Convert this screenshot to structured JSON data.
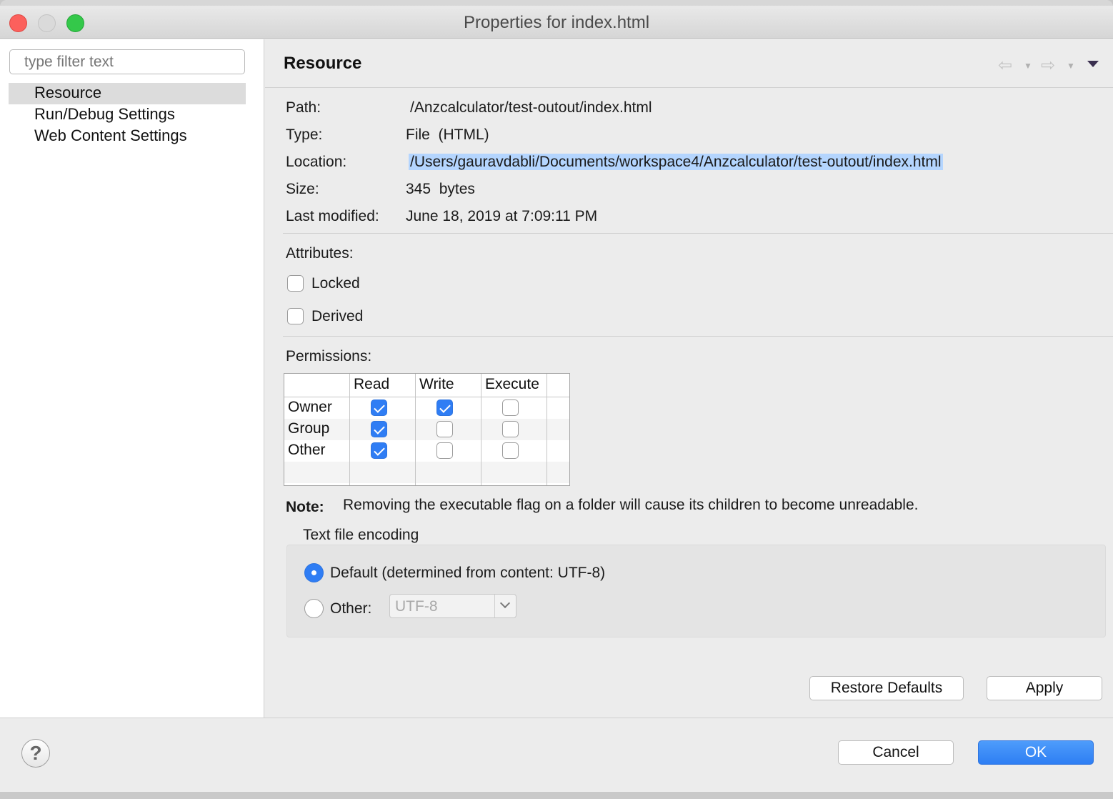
{
  "window": {
    "title": "Properties for index.html"
  },
  "nav": {
    "filter_placeholder": "type filter text",
    "items": [
      {
        "label": "Resource",
        "selected": true
      },
      {
        "label": "Run/Debug Settings",
        "selected": false
      },
      {
        "label": "Web Content Settings",
        "selected": false
      }
    ]
  },
  "page": {
    "title": "Resource",
    "info": {
      "path_label": "Path:",
      "path_value": "/Anzcalculator/test-outout/index.html",
      "type_label": "Type:",
      "type_value": "File  (HTML)",
      "location_label": "Location:",
      "location_value": "/Users/gauravdabli/Documents/workspace4/Anzcalculator/test-outout/index.html",
      "size_label": "Size:",
      "size_value": "345  bytes",
      "modified_label": "Last modified:",
      "modified_value": "June 18, 2019 at 7:09:11 PM"
    },
    "attributes": {
      "heading": "Attributes:",
      "locked_label": "Locked",
      "locked_checked": false,
      "derived_label": "Derived",
      "derived_checked": false
    },
    "permissions": {
      "heading": "Permissions:",
      "columns": [
        "Read",
        "Write",
        "Execute"
      ],
      "rows": [
        {
          "label": "Owner",
          "read": true,
          "write": true,
          "execute": false
        },
        {
          "label": "Group",
          "read": true,
          "write": false,
          "execute": false
        },
        {
          "label": "Other",
          "read": true,
          "write": false,
          "execute": false
        }
      ]
    },
    "note": {
      "label": "Note:",
      "text": "Removing the executable flag on a folder will cause its children to become unreadable."
    },
    "encoding": {
      "heading": "Text file encoding",
      "default_label": "Default (determined from content: UTF-8)",
      "default_selected": true,
      "other_label": "Other:",
      "other_value": "UTF-8"
    },
    "buttons": {
      "restore_defaults": "Restore Defaults",
      "apply": "Apply"
    }
  },
  "footer": {
    "help_symbol": "?",
    "cancel": "Cancel",
    "ok": "OK"
  },
  "colors": {
    "accent": "#2f7df4",
    "selection_highlight": "#b4d5fe",
    "close": "#fc605c",
    "maximize": "#34c84a"
  }
}
